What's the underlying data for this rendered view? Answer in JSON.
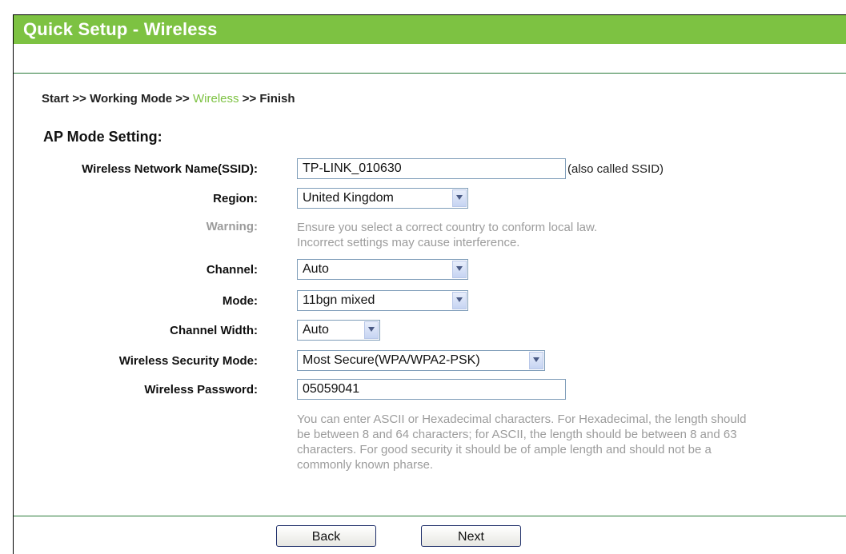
{
  "title": "Quick Setup - Wireless",
  "breadcrumb": {
    "start": "Start",
    "sep1": ">>",
    "working_mode": "Working Mode",
    "sep2": ">>",
    "wireless": "Wireless",
    "sep3": ">>",
    "finish": "Finish"
  },
  "section_title": "AP Mode Setting:",
  "fields": {
    "ssid": {
      "label": "Wireless Network Name(SSID):",
      "value": "TP-LINK_010630",
      "hint": "(also called SSID)"
    },
    "region": {
      "label": "Region:",
      "value": "United Kingdom"
    },
    "warning": {
      "label": "Warning:",
      "line1": "Ensure you select a correct country to conform local law.",
      "line2": "Incorrect settings may cause interference."
    },
    "channel": {
      "label": "Channel:",
      "value": "Auto"
    },
    "mode": {
      "label": "Mode:",
      "value": "11bgn mixed"
    },
    "channel_width": {
      "label": "Channel Width:",
      "value": "Auto"
    },
    "security_mode": {
      "label": "Wireless Security Mode:",
      "value": "Most Secure(WPA/WPA2-PSK)"
    },
    "password": {
      "label": "Wireless Password:",
      "value": "05059041",
      "help_line1": "You can enter ASCII or Hexadecimal characters. For Hexadecimal, the length should",
      "help_line2": "be between 8 and 64 characters; for ASCII, the length should be between 8 and 63",
      "help_line3": "characters. For good security it should be of ample length and should not be a",
      "help_line4": "commonly known pharse."
    }
  },
  "buttons": {
    "back": "Back",
    "next": "Next"
  },
  "colors": {
    "brand_green": "#7dc242",
    "divider": "#2a7a3a",
    "muted": "#9c9c9c"
  }
}
